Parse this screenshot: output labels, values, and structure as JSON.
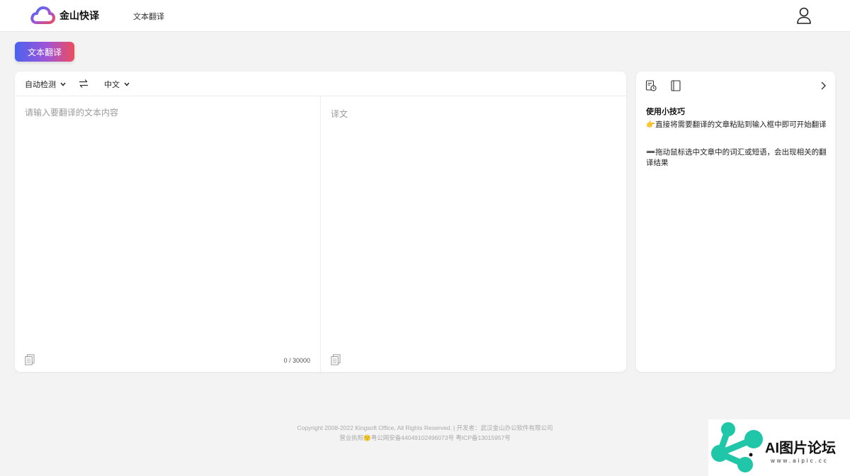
{
  "header": {
    "logo_text": "金山快译",
    "nav_link": "文本翻译"
  },
  "mode_button": "文本翻译",
  "translator": {
    "source_language": "自动检测",
    "target_language": "中文",
    "input_placeholder": "请输入要翻译的文本内容",
    "output_placeholder": "译文",
    "char_counter": "0 / 30000"
  },
  "tips": {
    "title": "使用小技巧",
    "items": [
      "👉直接将需要翻译的文章粘贴到输入框中即可开始翻译",
      "➖拖动鼠标选中文章中的词汇或短语，会出现相关的翻译结果"
    ]
  },
  "footer": {
    "line1": "Copyright 2008-2022 Kingsoft Office, All Rights Reserved. | 开发者：武汉金山办公软件有限公司",
    "line2": "营业执照🙂粤公网安备44049102496073号 粤ICP备13015957号"
  },
  "watermark": {
    "title": "AI图片论坛",
    "subtitle": "www.aipic.cc"
  },
  "colors": {
    "brand_gradient_start": "#4a63f0",
    "brand_gradient_end": "#ee4c5c",
    "watermark_teal": "#1fc7a8"
  }
}
